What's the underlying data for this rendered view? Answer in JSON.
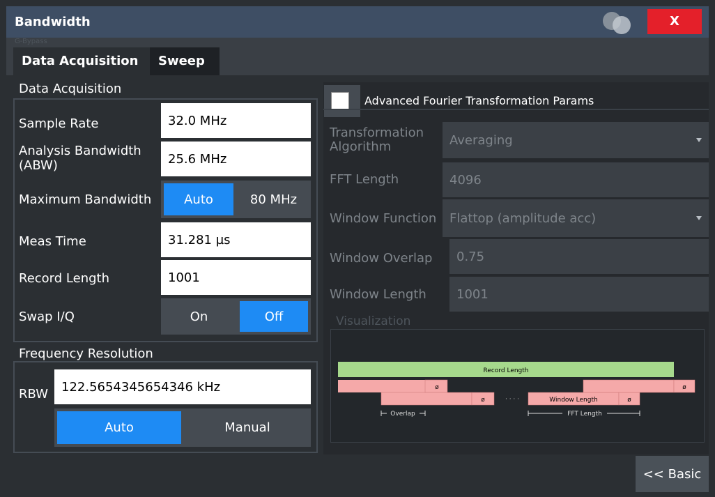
{
  "dialog": {
    "title": "Bandwidth",
    "close_label": "X",
    "faint_label": "G-Bypass"
  },
  "tabs": [
    {
      "label": "Data Acquisition"
    },
    {
      "label": "Sweep"
    }
  ],
  "data_acquisition": {
    "section_title": "Data Acquisition",
    "sample_rate": {
      "label": "Sample Rate",
      "value": "32.0 MHz"
    },
    "analysis_bandwidth": {
      "label": "Analysis Bandwidth (ABW)",
      "value": "25.6 MHz"
    },
    "maximum_bandwidth": {
      "label": "Maximum Bandwidth",
      "auto_label": "Auto",
      "value": "80 MHz"
    },
    "meas_time": {
      "label": "Meas Time",
      "value": "31.281 µs"
    },
    "record_length": {
      "label": "Record Length",
      "value": "1001"
    },
    "swap_iq": {
      "label": "Swap I/Q",
      "on_label": "On",
      "off_label": "Off",
      "selected": "Off"
    }
  },
  "frequency_resolution": {
    "section_title": "Frequency Resolution",
    "rbw_label": "RBW",
    "rbw_value": "122.5654345654346 kHz",
    "auto_label": "Auto",
    "manual_label": "Manual",
    "selected": "Auto"
  },
  "advanced": {
    "checkbox_label": "Advanced Fourier Transformation Params",
    "checked": false,
    "transformation_algorithm": {
      "label": "Transformation Algorithm",
      "value": "Averaging"
    },
    "fft_length": {
      "label": "FFT Length",
      "value": "4096"
    },
    "window_function": {
      "label": "Window Function",
      "value": "Flattop (amplitude acc)"
    },
    "window_overlap": {
      "label": "Window Overlap",
      "value": "0.75"
    },
    "window_length": {
      "label": "Window Length",
      "value": "1001"
    },
    "visualization": {
      "title": "Visualization",
      "record_length_label": "Record Length",
      "zero_symbol": "ø",
      "dots": "· · · ·",
      "window_length_label": "Window Length",
      "overlap_label": "Overlap",
      "fft_length_label": "FFT Length"
    }
  },
  "footer": {
    "basic_button_label": "<< Basic"
  },
  "colors": {
    "title_bar": "#3e4e64",
    "close_button": "#e4202a",
    "toggle_active": "#1e8bf4",
    "record_length_bar": "#a6d98c",
    "window_bar": "#f5a9a9"
  },
  "icons": {
    "title_decoration": "overlapping-circles-icon",
    "dropdown": "chevron-down-icon"
  }
}
